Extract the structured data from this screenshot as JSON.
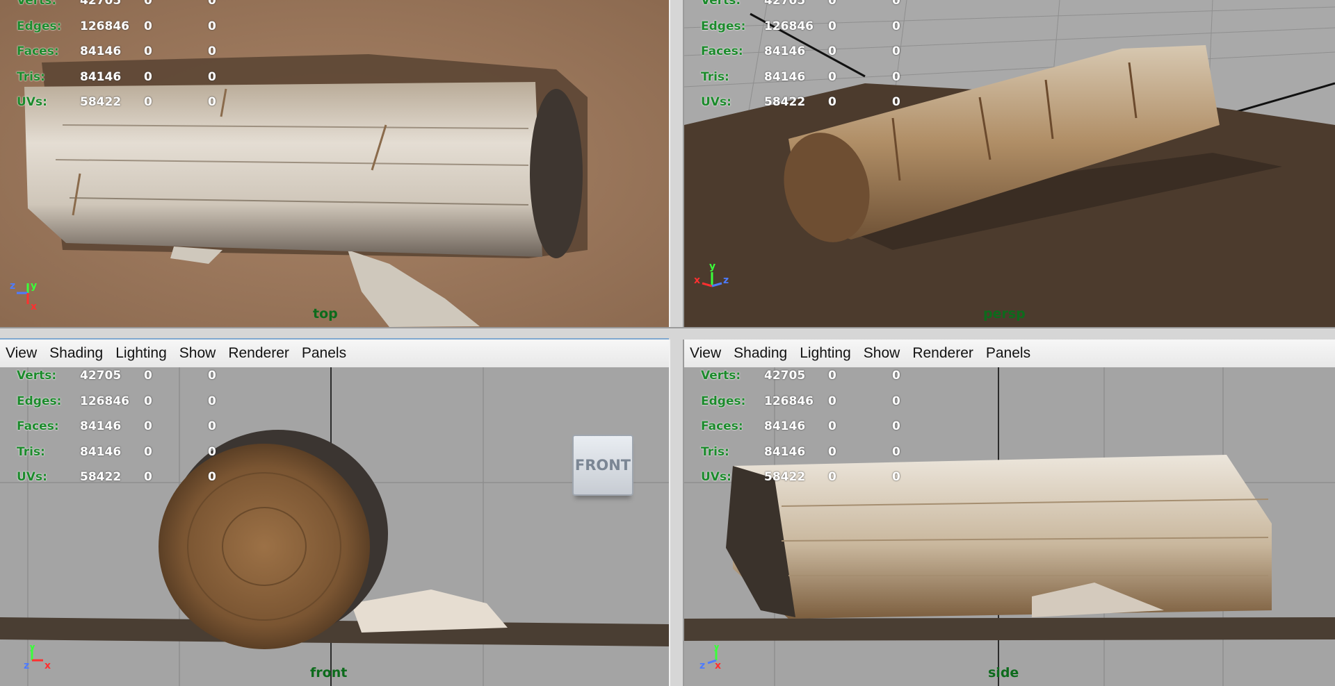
{
  "menu": {
    "items": [
      "View",
      "Shading",
      "Lighting",
      "Show",
      "Renderer",
      "Panels"
    ]
  },
  "hud": {
    "labels": {
      "verts": "Verts:",
      "edges": "Edges:",
      "faces": "Faces:",
      "tris": "Tris:",
      "uvs": "UVs:"
    },
    "verts": [
      "42705",
      "0",
      "0"
    ],
    "edges": [
      "126846",
      "0",
      "0"
    ],
    "faces": [
      "84146",
      "0",
      "0"
    ],
    "tris": [
      "84146",
      "0",
      "0"
    ],
    "uvs": [
      "58422",
      "0",
      "0"
    ]
  },
  "viewports": {
    "top": {
      "camera": "top"
    },
    "persp": {
      "camera": "persp"
    },
    "front": {
      "camera": "front",
      "viewcube": "FRONT"
    },
    "side": {
      "camera": "side"
    }
  },
  "colors": {
    "hud_label": "#1c8a2c",
    "camera_label": "#0d6b1c",
    "active_panel": "#7ea7cf",
    "viewport_bg": "#a4a4a4"
  }
}
